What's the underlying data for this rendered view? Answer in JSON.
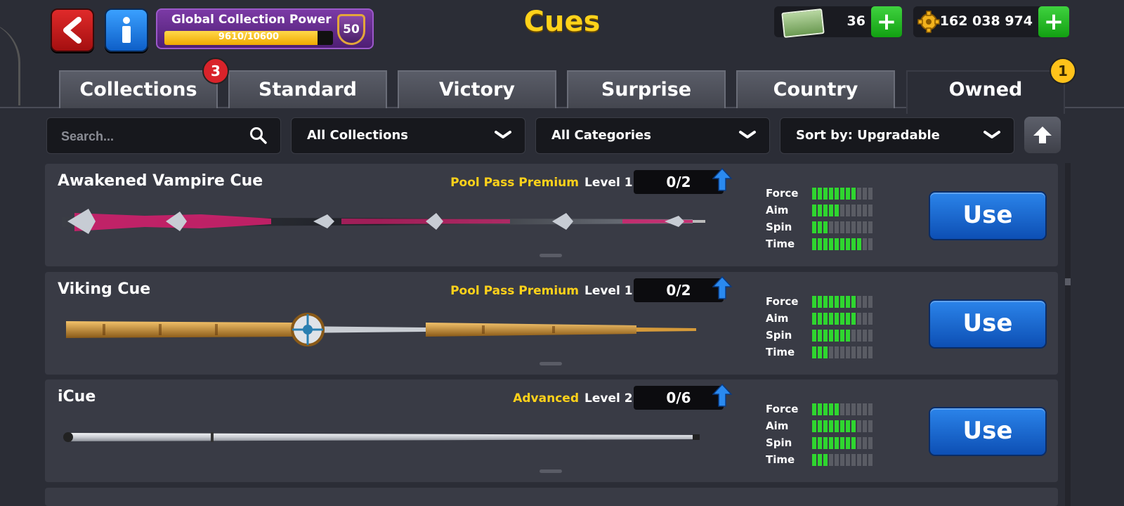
{
  "header": {
    "title": "Cues",
    "gcp": {
      "label": "Global Collection Power",
      "progress_text": "9610/10600",
      "progress_fraction": 0.9066,
      "level": "50"
    },
    "cash": {
      "value": "36"
    },
    "coins": {
      "value": "162 038 974"
    },
    "plus_label": "+"
  },
  "tabs": [
    {
      "label": "Collections",
      "badge": "3",
      "active": false
    },
    {
      "label": "Standard",
      "active": false
    },
    {
      "label": "Victory",
      "active": false
    },
    {
      "label": "Surprise",
      "active": false
    },
    {
      "label": "Country",
      "active": false
    },
    {
      "label": "Owned",
      "badge": "1",
      "active": true
    }
  ],
  "filters": {
    "search_placeholder": "Search...",
    "collections": "All Collections",
    "categories": "All Categories",
    "sort": "Sort by: Upgradable"
  },
  "cues": [
    {
      "name": "Awakened Vampire Cue",
      "tag": "Pool Pass Premium",
      "level": "Level 1",
      "progress": "0/2",
      "stats": {
        "force": 8,
        "aim": 5,
        "spin": 3,
        "time": 9
      },
      "use_label": "Use"
    },
    {
      "name": "Viking Cue",
      "tag": "Pool Pass Premium",
      "level": "Level 1",
      "progress": "0/2",
      "stats": {
        "force": 8,
        "aim": 8,
        "spin": 7,
        "time": 3
      },
      "use_label": "Use"
    },
    {
      "name": "iCue",
      "tag": "Advanced",
      "level": "Level 2",
      "progress": "0/6",
      "stats": {
        "force": 5,
        "aim": 8,
        "spin": 8,
        "time": 3
      },
      "use_label": "Use"
    }
  ],
  "stat_labels": {
    "force": "Force",
    "aim": "Aim",
    "spin": "Spin",
    "time": "Time"
  },
  "stat_max": 11,
  "colors": {
    "accent_yellow": "#ffd21a",
    "use_blue": "#1f6fd6",
    "stat_green": "#2fd62f",
    "back_red": "#d9232a",
    "info_blue": "#2a8af0",
    "gcp_purple": "#6a2f94"
  },
  "icons": {
    "back": "back-arrow-icon",
    "info": "info-icon",
    "search": "search-icon",
    "chevron": "chevron-down-icon",
    "sort_up": "arrow-up-icon",
    "cash": "cash-icon",
    "coin": "coin-gear-icon"
  }
}
